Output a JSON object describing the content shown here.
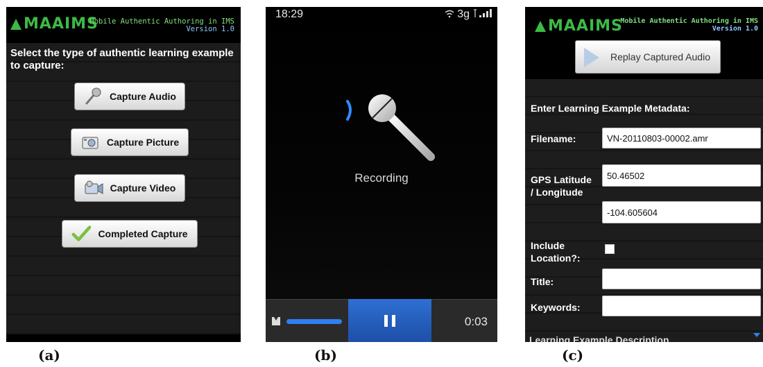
{
  "panel_a": {
    "logo_text": "MAAIMS",
    "app_name": "Mobile Authentic Authoring in IMS",
    "version": "Version 1.0",
    "prompt": "Select the type of authentic learning example to capture:",
    "buttons": [
      {
        "label": "Capture Audio",
        "icon": "microphone-icon"
      },
      {
        "label": "Capture Picture",
        "icon": "camera-icon"
      },
      {
        "label": "Capture Video",
        "icon": "video-camera-icon"
      },
      {
        "label": "Completed Capture",
        "icon": "checkmark-icon"
      }
    ]
  },
  "panel_b": {
    "status_time": "18:29",
    "network": "3g",
    "status_text": "Recording",
    "elapsed": "0:03"
  },
  "panel_c": {
    "logo_text": "MAAIMS",
    "app_name": "Mobile Authentic Authoring in IMS",
    "version": "Version 1.0",
    "replay_label": "Replay Captured Audio",
    "section_title": "Enter Learning Example Metadata:",
    "filename_label": "Filename:",
    "filename_value": "VN-20110803-00002.amr",
    "gps_label": "GPS Latitude / Longitude",
    "latitude": "50.46502",
    "longitude": "-104.605604",
    "include_location_label": "Include Location?:",
    "title_label": "Title:",
    "title_value": "",
    "keywords_label": "Keywords:",
    "keywords_value": "",
    "cutoff_label": "Learning Example Description"
  },
  "captions": [
    "(a)",
    "(b)",
    "(c)"
  ]
}
